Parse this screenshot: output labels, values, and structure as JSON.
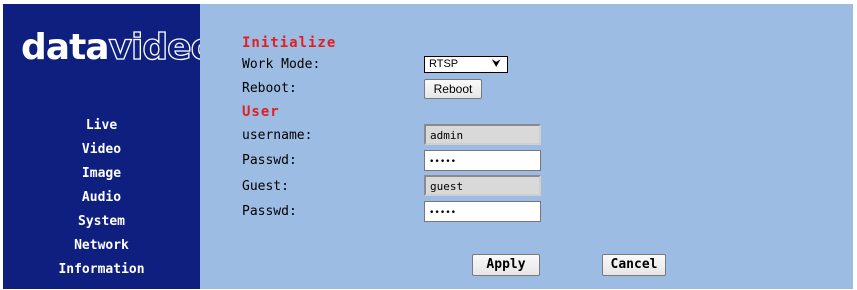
{
  "brand": {
    "part1": "data",
    "part2": "video"
  },
  "nav": {
    "items": [
      {
        "label": "Live"
      },
      {
        "label": "Video"
      },
      {
        "label": "Image"
      },
      {
        "label": "Audio"
      },
      {
        "label": "System"
      },
      {
        "label": "Network"
      },
      {
        "label": "Information"
      }
    ]
  },
  "initialize": {
    "title": "Initialize",
    "work_mode_label": "Work Mode:",
    "work_mode_value": "RTSP",
    "reboot_label": "Reboot:",
    "reboot_button": "Reboot"
  },
  "user": {
    "title": "User",
    "username_label": "username:",
    "username_value": "admin",
    "passwd_label": "Passwd:",
    "passwd_value": "•••••",
    "guest_label": "Guest:",
    "guest_value": "guest",
    "guest_passwd_label": "Passwd:",
    "guest_passwd_value": "•••••"
  },
  "actions": {
    "apply": "Apply",
    "cancel": "Cancel"
  },
  "colors": {
    "sidebar": "#0f1f80",
    "content": "#9cbce3",
    "section_title": "#e02020"
  }
}
